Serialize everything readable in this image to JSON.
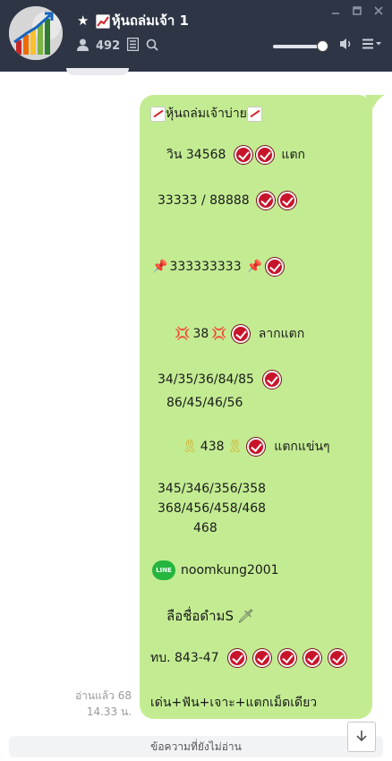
{
  "header": {
    "title": "หุ้นถล่มเจ้า 1",
    "member_count": "492",
    "icons": [
      "star-icon",
      "chart-up-icon",
      "member-icon",
      "notes-icon",
      "search-icon",
      "speaker-icon",
      "menu-icon",
      "minimize-icon",
      "maximize-icon",
      "close-icon"
    ],
    "volume_level": 0.9
  },
  "message": {
    "lines": {
      "l1": "หุ้นถล่มเจ้าบ่าย",
      "l2": "วิน 34568",
      "l2_suffix": "แตก",
      "l3": "33333 / 88888",
      "l4": "333333333",
      "l5": "38",
      "l5_suffix": "ลากแตก",
      "l6": "34/35/36/84/85",
      "l7": "86/45/46/56",
      "l8": "438",
      "l8_suffix": "แตกแข่นๆ",
      "l9": "345/346/356/358",
      "l10": "368/456/458/468",
      "l11": "468",
      "l12": "noomkung2001",
      "l13": "ลือชื่อดำมS",
      "l14": "ทบ. 843-47",
      "l15": "เด่น+ฟัน+เจาะ+แตกเม็ดเดียว"
    },
    "line_logo": "LINE"
  },
  "read_status": {
    "read": "อ่านแล้ว 68",
    "time": "14.33 น."
  },
  "unread_label": "ข้อความที่ยังไม่อ่าน",
  "colors": {
    "header_bg": "#2e3646",
    "bubble_bg": "#c3ec92",
    "check_red": "#c8142a",
    "line_green": "#25b63f"
  }
}
